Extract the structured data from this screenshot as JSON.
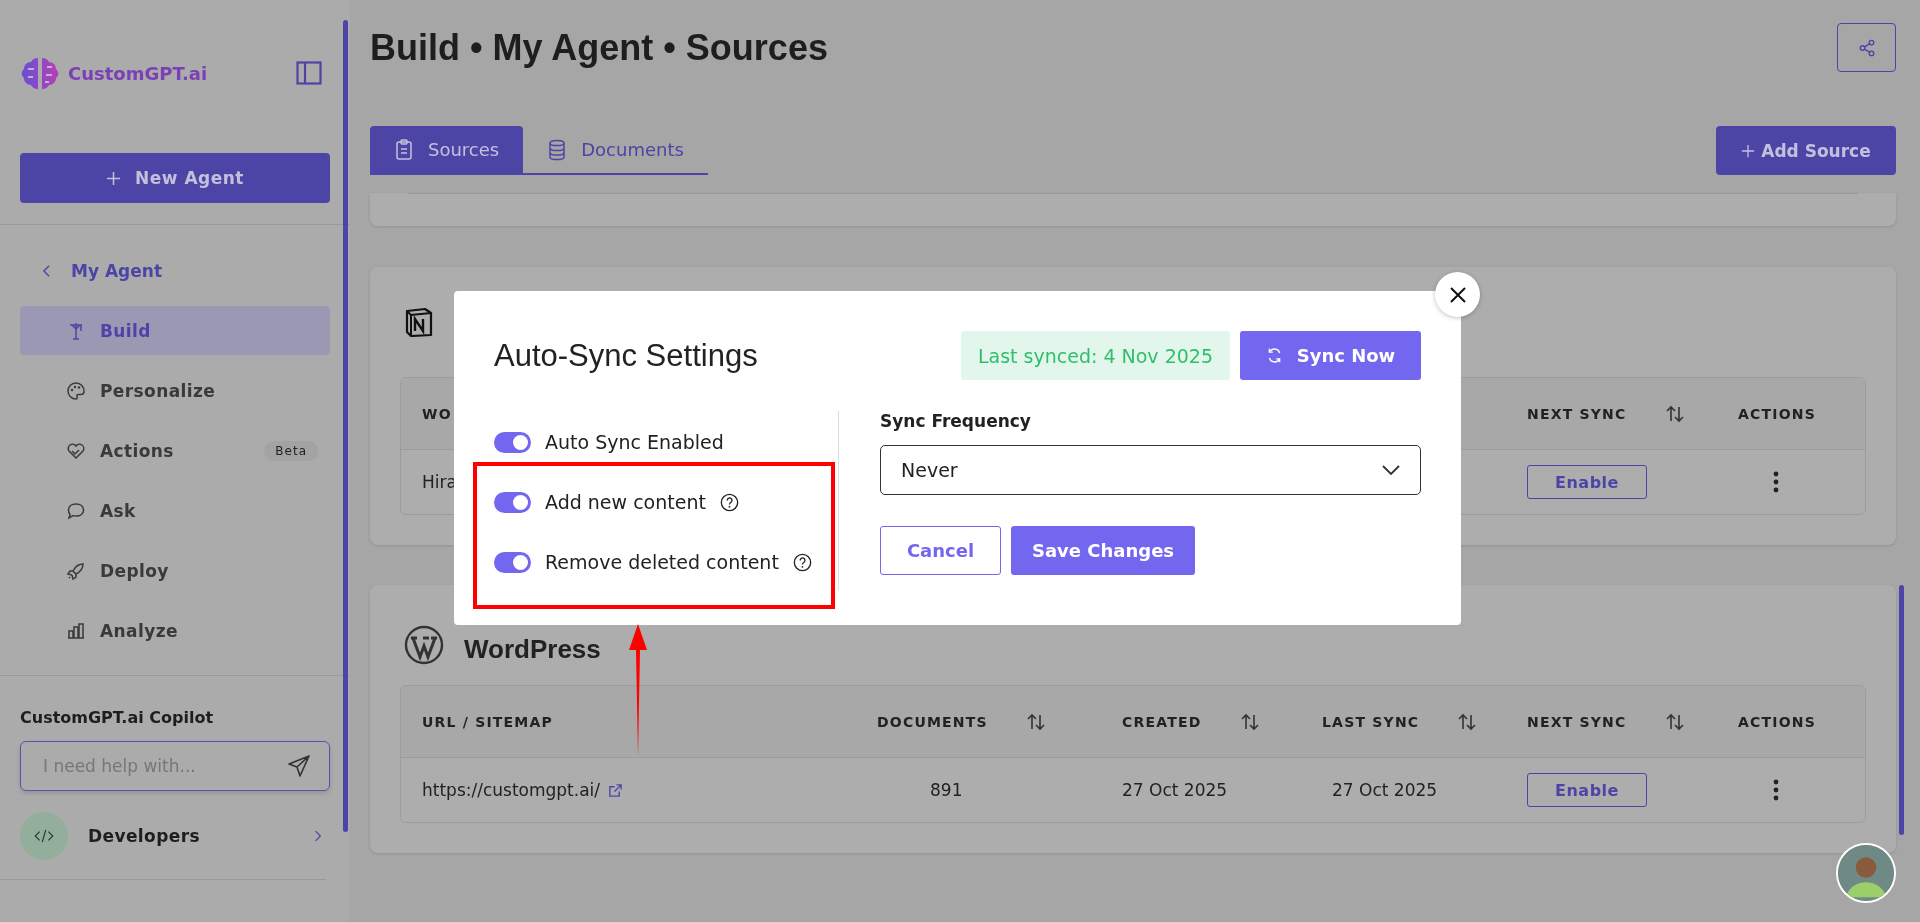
{
  "sidebar": {
    "brand": "CustomGPT.ai",
    "new_agent_button": "New Agent",
    "back_link": "My Agent",
    "items": [
      {
        "label": "Build",
        "selected": true
      },
      {
        "label": "Personalize",
        "selected": false
      },
      {
        "label": "Actions",
        "selected": false,
        "badge": "Beta"
      },
      {
        "label": "Ask",
        "selected": false
      },
      {
        "label": "Deploy",
        "selected": false
      },
      {
        "label": "Analyze",
        "selected": false
      }
    ],
    "copilot": {
      "title": "CustomGPT.ai Copilot",
      "placeholder": "I need help with..."
    },
    "developers": "Developers"
  },
  "header": {
    "title": "Build • My Agent • Sources"
  },
  "tabs": [
    {
      "label": "Sources",
      "selected": true
    },
    {
      "label": "Documents",
      "selected": false
    }
  ],
  "add_source_button": "Add Source",
  "sources": [
    {
      "kind": "notion",
      "columns": [
        {
          "kind": "text",
          "label": "WO",
          "sortable": false
        },
        {
          "kind": "button",
          "label": "NEXT SYNC",
          "sortable": true
        },
        {
          "kind": "menu",
          "label": "ACTIONS",
          "sortable": false
        }
      ],
      "rows": [
        {
          "cells": [
            "Hira",
            "Enable"
          ]
        }
      ]
    },
    {
      "kind": "wordpress",
      "title": "WordPress",
      "columns": [
        {
          "kind": "text",
          "label": "URL / SITEMAP",
          "sortable": false
        },
        {
          "kind": "text",
          "label": "DOCUMENTS",
          "sortable": true
        },
        {
          "kind": "text",
          "label": "CREATED",
          "sortable": true
        },
        {
          "kind": "text",
          "label": "LAST SYNC",
          "sortable": true
        },
        {
          "kind": "button",
          "label": "NEXT SYNC",
          "sortable": true
        },
        {
          "kind": "menu",
          "label": "ACTIONS",
          "sortable": false
        }
      ],
      "rows": [
        {
          "cells": [
            "https://customgpt.ai/",
            "891",
            "27 Oct 2025",
            "27 Oct 2025",
            "Enable"
          ],
          "external_link": true
        }
      ]
    }
  ],
  "modal": {
    "title": "Auto-Sync Settings",
    "last_synced": "Last synced: 4 Nov 2025",
    "sync_now_button": "Sync Now",
    "toggles": [
      {
        "label": "Auto Sync Enabled",
        "on": true
      },
      {
        "label": "Add new content",
        "on": true,
        "help": true
      },
      {
        "label": "Remove deleted content",
        "on": true,
        "help": true
      }
    ],
    "frequency": {
      "label": "Sync Frequency",
      "value": "Never"
    },
    "cancel_button": "Cancel",
    "save_button": "Save Changes"
  }
}
